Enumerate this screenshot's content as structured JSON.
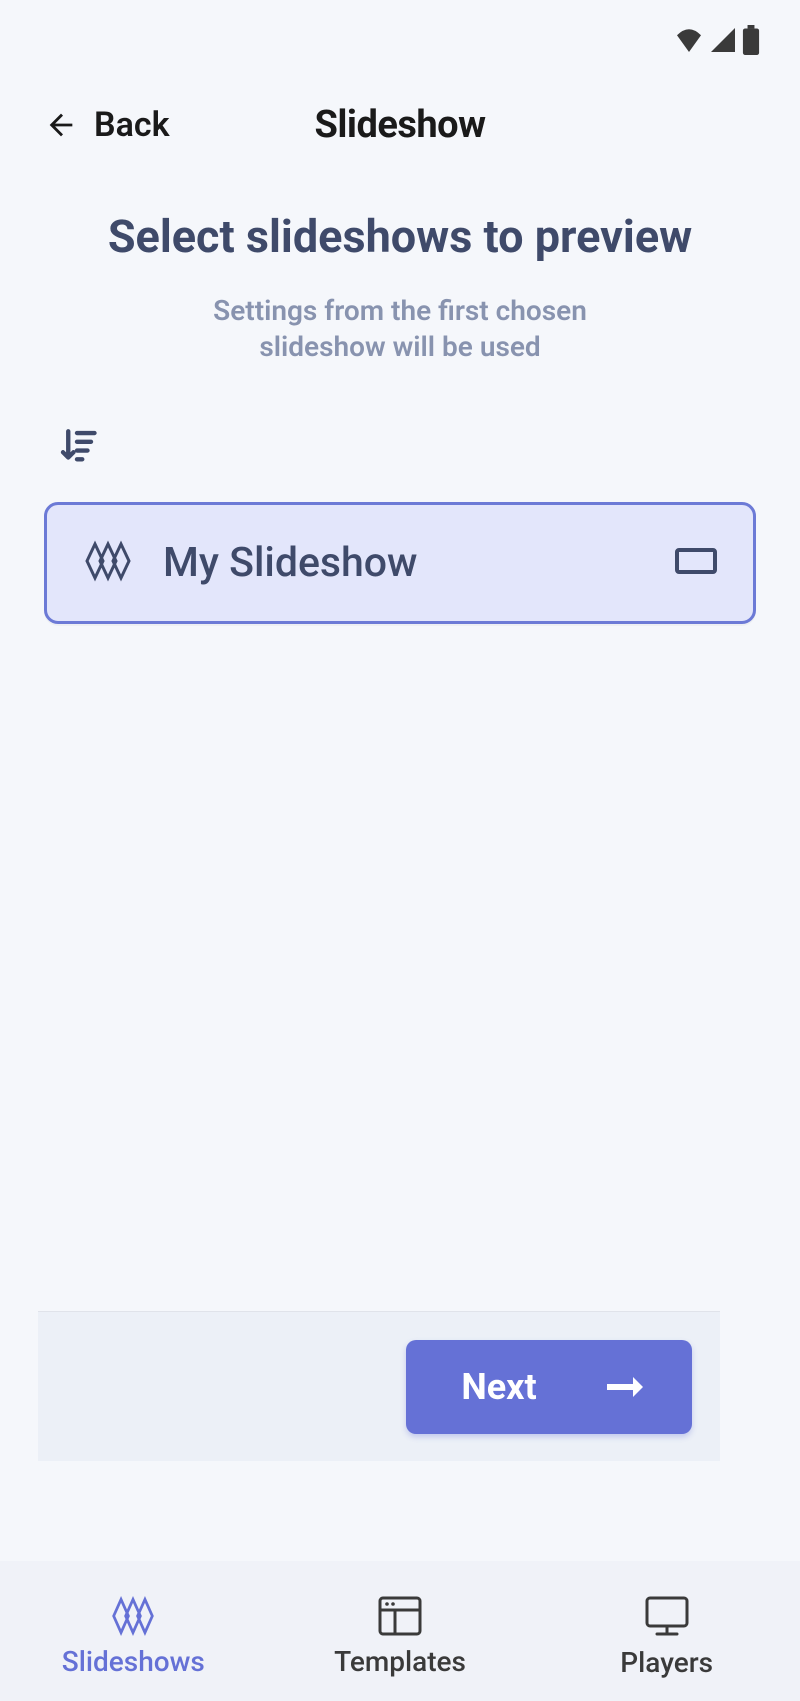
{
  "header": {
    "back_label": "Back",
    "title": "Slideshow"
  },
  "page": {
    "heading": "Select slideshows to preview",
    "helper_line1": "Settings from the first chosen",
    "helper_line2": "slideshow will be used"
  },
  "slideshows": [
    {
      "label": "My Slideshow"
    }
  ],
  "footer": {
    "next_label": "Next"
  },
  "nav": {
    "slideshows": "Slideshows",
    "templates": "Templates",
    "players": "Players"
  },
  "colors": {
    "accent": "#6571d6",
    "heading": "#3f4a6a",
    "muted": "#8893af",
    "card_bg": "#e3e6fb"
  }
}
